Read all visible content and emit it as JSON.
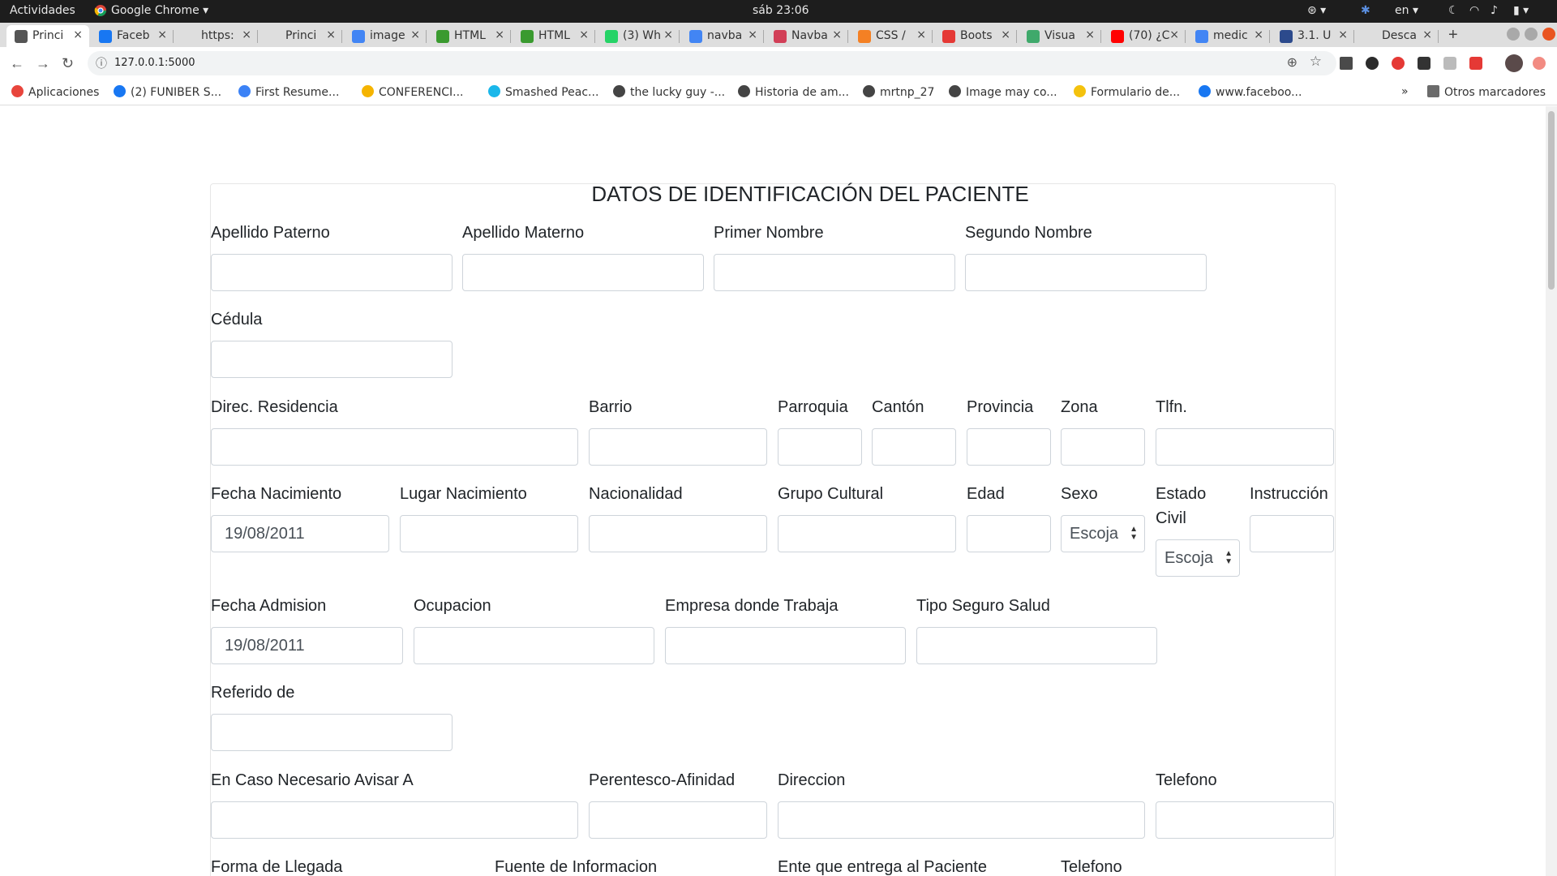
{
  "topbar": {
    "activities": "Actividades",
    "app_name": "Google Chrome",
    "clock": "sáb 23:06",
    "lang": "en"
  },
  "tabs": [
    {
      "label": "Princi",
      "icon": "globe-icon",
      "color": "#555555",
      "active": true
    },
    {
      "label": "Faceb",
      "icon": "facebook-icon",
      "color": "#1877f2"
    },
    {
      "label": "https:",
      "icon": "blank-icon",
      "color": "#dedede"
    },
    {
      "label": "Princi",
      "icon": "blank-icon",
      "color": "#dedede"
    },
    {
      "label": "image",
      "icon": "google-icon",
      "color": "#4285f4"
    },
    {
      "label": "HTML",
      "icon": "sheet-icon",
      "color": "#3a9a2f"
    },
    {
      "label": "HTML",
      "icon": "sheet-icon",
      "color": "#3a9a2f"
    },
    {
      "label": "(3) Wh",
      "icon": "whatsapp-icon",
      "color": "#25d366"
    },
    {
      "label": "navba",
      "icon": "google-icon",
      "color": "#4285f4"
    },
    {
      "label": "Navba",
      "icon": "m-icon",
      "color": "#d23f57"
    },
    {
      "label": "CSS /",
      "icon": "stackoverflow-icon",
      "color": "#f48024"
    },
    {
      "label": "Boots",
      "icon": "s-icon",
      "color": "#e53935"
    },
    {
      "label": "Visua",
      "icon": "visual-icon",
      "color": "#3fa96b"
    },
    {
      "label": "(70) ¿C",
      "icon": "youtube-icon",
      "color": "#ff0000"
    },
    {
      "label": "medic",
      "icon": "google-icon",
      "color": "#4285f4"
    },
    {
      "label": "3.1. U",
      "icon": "blue-dot-icon",
      "color": "#2c4a8c"
    },
    {
      "label": "Desca",
      "icon": "blank-icon",
      "color": "#dedede"
    }
  ],
  "toolbar": {
    "url": "127.0.0.1:5000"
  },
  "bookmarks": [
    {
      "label": "Aplicaciones",
      "icon": "apps-grid-icon",
      "color": "#e8453c"
    },
    {
      "label": "(2) FUNIBER S...",
      "icon": "facebook-icon",
      "color": "#1877f2"
    },
    {
      "label": "First Resume...",
      "icon": "arrow-icon",
      "color": "#3b82f6"
    },
    {
      "label": "CONFERENCI...",
      "icon": "drive-icon",
      "color": "#f5b400"
    },
    {
      "label": "Smashed Peac...",
      "icon": "v-icon",
      "color": "#1ab7ea"
    },
    {
      "label": "the lucky guy -...",
      "icon": "globe-icon",
      "color": "#444444"
    },
    {
      "label": "Historia de am...",
      "icon": "globe-icon",
      "color": "#444444"
    },
    {
      "label": "mrtnp_27",
      "icon": "globe-icon",
      "color": "#444444"
    },
    {
      "label": "Image may co...",
      "icon": "globe-icon",
      "color": "#444444"
    },
    {
      "label": "Formulario de...",
      "icon": "flag-icon",
      "color": "#f4c20d"
    },
    {
      "label": "www.faceboo...",
      "icon": "facebook-icon",
      "color": "#1877f2"
    }
  ],
  "bookmarks_more": "»",
  "other_bookmarks": "Otros marcadores",
  "form": {
    "title": "DATOS DE IDENTIFICACIÓN DEL PACIENTE",
    "apellido_paterno": "Apellido Paterno",
    "apellido_materno": "Apellido Materno",
    "primer_nombre": "Primer Nombre",
    "segundo_nombre": "Segundo Nombre",
    "cedula": "Cédula",
    "direc_residencia": "Direc. Residencia",
    "barrio": "Barrio",
    "parroquia": "Parroquia",
    "canton": "Cantón",
    "provincia": "Provincia",
    "zona": "Zona",
    "tlfn": "Tlfn.",
    "fecha_nacimiento": "Fecha Nacimiento",
    "fecha_nacimiento_value": "19/08/2011",
    "lugar_nacimiento": "Lugar Nacimiento",
    "nacionalidad": "Nacionalidad",
    "grupo_cultural": "Grupo Cultural",
    "edad": "Edad",
    "sexo": "Sexo",
    "sexo_value": "Escoja",
    "estado_civil": "Estado Civil",
    "estado_civil_value": "Escoja",
    "instruccion": "Instrucción",
    "fecha_admision": "Fecha Admision",
    "fecha_admision_value": "19/08/2011",
    "ocupacion": "Ocupacion",
    "empresa": "Empresa donde Trabaja",
    "tipo_seguro": "Tipo Seguro Salud",
    "referido_de": "Referido de",
    "avisar_a": "En Caso Necesario Avisar A",
    "parentesco": "Perentesco-Afinidad",
    "direccion": "Direccion",
    "telefono": "Telefono",
    "forma_llegada": "Forma de Llegada",
    "fuente_informacion": "Fuente de Informacion",
    "ente_entrega": "Ente que entrega al Paciente",
    "telefono2": "Telefono"
  }
}
